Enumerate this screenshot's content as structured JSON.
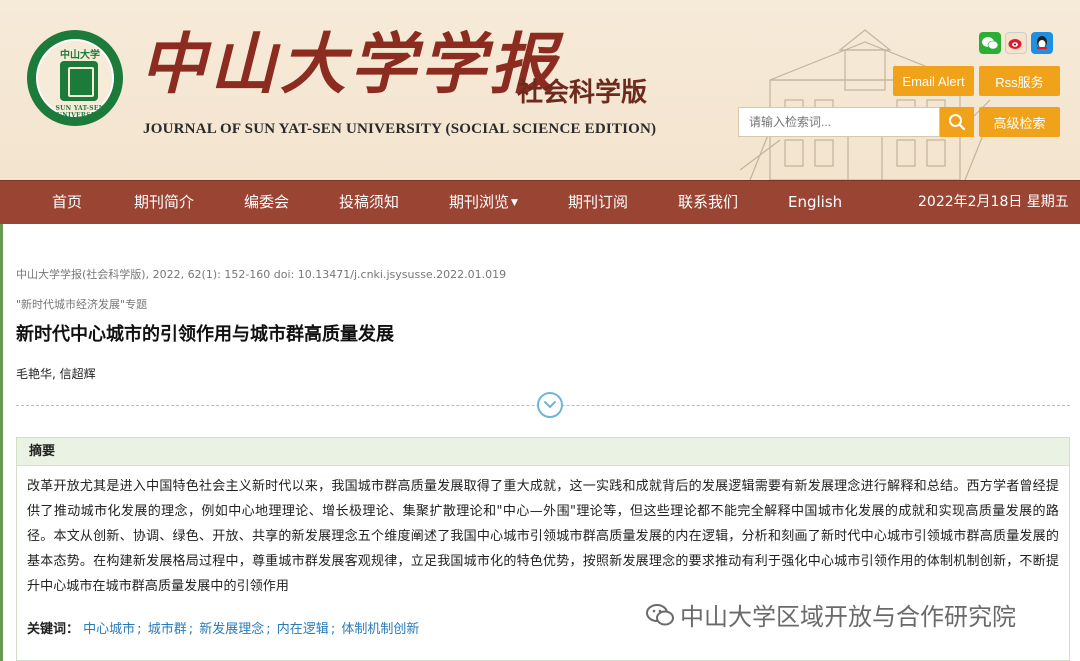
{
  "header": {
    "title": "中山大学学报",
    "subtitle": "社会科学版",
    "english_title": "JOURNAL OF SUN YAT-SEN UNIVERSITY (SOCIAL SCIENCE EDITION)",
    "seal_text": "中山大学",
    "seal_english": "SUN YAT-SEN UNIVERSITY",
    "email_alert": "Email Alert",
    "rss": "Rss服务",
    "advanced_search": "高级检索",
    "search_placeholder": "请输入检索词...",
    "social_icons": [
      "wechat-icon",
      "weibo-icon",
      "qq-icon"
    ]
  },
  "nav": {
    "items": [
      {
        "label": "首页"
      },
      {
        "label": "期刊简介"
      },
      {
        "label": "编委会"
      },
      {
        "label": "投稿须知"
      },
      {
        "label": "期刊浏览",
        "dropdown": true
      },
      {
        "label": "期刊订阅"
      },
      {
        "label": "联系我们"
      },
      {
        "label": "English"
      }
    ],
    "date": "2022年2月18日 星期五"
  },
  "article": {
    "citation": "中山大学学报(社会科学版), 2022, 62(1): 152-160 doi: 10.13471/j.cnki.jsysusse.2022.01.019",
    "column": "\"新时代城市经济发展\"专题",
    "title": "新时代中心城市的引领作用与城市群高质量发展",
    "authors": "毛艳华, 信超辉",
    "abstract_heading": "摘要",
    "abstract": "改革开放尤其是进入中国特色社会主义新时代以来，我国城市群高质量发展取得了重大成就，这一实践和成就背后的发展逻辑需要有新发展理念进行解释和总结。西方学者曾经提供了推动城市化发展的理念，例如中心地理理论、增长极理论、集聚扩散理论和\"中心—外围\"理论等，但这些理论都不能完全解释中国城市化发展的成就和实现高质量发展的路径。本文从创新、协调、绿色、开放、共享的新发展理念五个维度阐述了我国中心城市引领城市群高质量发展的内在逻辑，分析和刻画了新时代中心城市引领城市群高质量发展的基本态势。在构建新发展格局过程中，尊重城市群发展客观规律，立足我国城市化的特色优势，按照新发展理念的要求推动有利于强化中心城市引领作用的体制机制创新，不断提升中心城市在城市群高质量发展中的引领作用",
    "keywords_label": "关键词：",
    "keywords": [
      "中心城市",
      "城市群",
      "新发展理念",
      "内在逻辑",
      "体制机制创新"
    ]
  },
  "watermark": {
    "text": "中山大学区域开放与合作研究院"
  },
  "colors": {
    "nav_bg": "#9a4434",
    "title_red": "#8c2b20",
    "accent_orange": "#f0a21b",
    "keyword_blue": "#2a7ab8",
    "abstract_head_bg": "#eaf3e3"
  }
}
